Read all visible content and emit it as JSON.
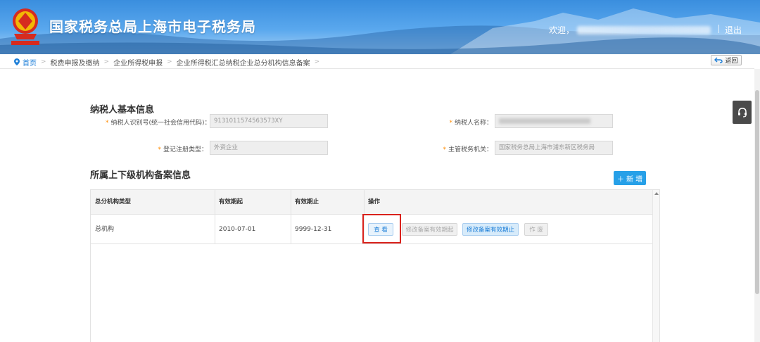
{
  "header": {
    "title": "国家税务总局上海市电子税务局",
    "welcome_prefix": "欢迎，",
    "logout": "退出",
    "logo_icon": "tax-emblem-icon"
  },
  "breadcrumb": {
    "items": [
      "首页",
      "税费申报及缴纳",
      "企业所得税申报",
      "企业所得税汇总纳税企业总分机构信息备案"
    ],
    "back_label": "返回"
  },
  "basic_info": {
    "title": "纳税人基本信息",
    "taxpayer_id_label": "纳税人识别号(统一社会信用代码)：",
    "taxpayer_id_value": "9131011574563573XY",
    "taxpayer_name_label": "纳税人名称：",
    "reg_type_label": "登记注册类型：",
    "reg_type_value": "外资企业",
    "tax_office_label": "主管税务机关：",
    "tax_office_value": "国家税务总局上海市浦东新区税务局"
  },
  "org_info": {
    "title": "所属上下级机构备案信息",
    "add_label": "＋ 新 增",
    "columns": [
      "总分机构类型",
      "有效期起",
      "有效期止",
      "操作"
    ],
    "rows": [
      {
        "type": "总机构",
        "start": "2010-07-01",
        "end": "9999-12-31",
        "actions": [
          "查 看",
          "修改备案有效期起",
          "修改备案有效期止",
          "作 废"
        ]
      }
    ]
  },
  "colors": {
    "header_blue": "#3a8ede",
    "primary": "#27a0e8",
    "highlight": "#d9221c",
    "required": "#ff8c00"
  }
}
